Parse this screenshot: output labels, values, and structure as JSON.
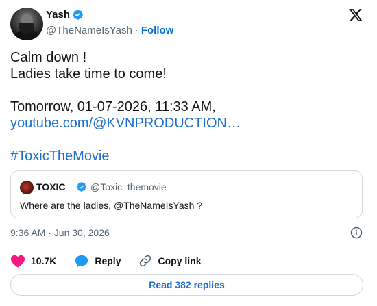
{
  "author": {
    "name": "Yash",
    "handle": "@TheNameIsYash",
    "separator": "·",
    "follow_label": "Follow"
  },
  "tweet": {
    "lines": [
      "Calm down !",
      "Ladies take time to come!"
    ],
    "schedule_line": "Tomorrow, 01-07-2026, 11:33 AM,",
    "link_text": "youtube.com/@KVNPRODUCTION…",
    "hashtag": "#ToxicTheMovie"
  },
  "quote": {
    "name": "TOXIC",
    "handle": "@Toxic_themovie",
    "text": "Where are the ladies, @TheNameIsYash ?"
  },
  "meta": {
    "timestamp": "9:36 AM · Jun 30, 2026"
  },
  "actions": {
    "like_count": "10.7K",
    "reply_label": "Reply",
    "copy_link_label": "Copy link"
  },
  "replies_button": "Read 382 replies",
  "colors": {
    "link": "#1d6fcf",
    "like": "#f91880",
    "verified": "#1d9bf0",
    "muted": "#536471"
  },
  "icons": [
    "verified-badge-icon",
    "x-logo-icon",
    "info-icon",
    "heart-icon",
    "reply-bubble-icon",
    "link-icon"
  ]
}
